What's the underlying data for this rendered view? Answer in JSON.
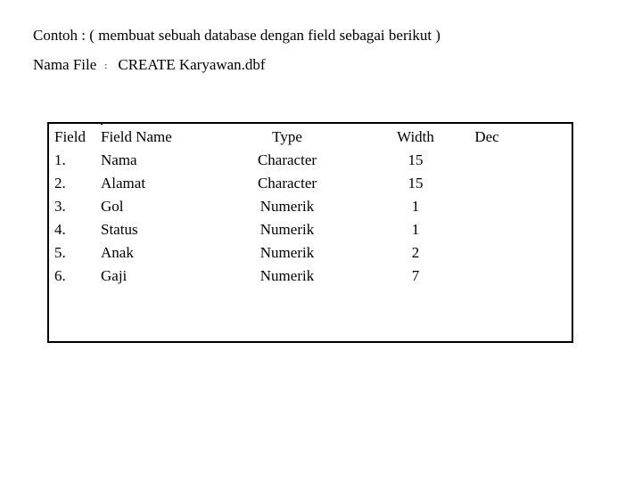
{
  "intro": "Contoh : ( membuat sebuah database dengan field sebagai berikut )",
  "file_label": "Nama File",
  "file_separator": ":",
  "file_command": "CREATE Karyawan.dbf",
  "table": {
    "headers": {
      "field": "Field",
      "name": "Field Name",
      "type": "Type",
      "width": "Width",
      "dec": "Dec"
    },
    "rows": [
      {
        "field": "1.",
        "name": "Nama",
        "type": "Character",
        "width": "15",
        "dec": ""
      },
      {
        "field": "2.",
        "name": "Alamat",
        "type": "Character",
        "width": "15",
        "dec": ""
      },
      {
        "field": "3.",
        "name": "Gol",
        "type": "Numerik",
        "width": "1",
        "dec": ""
      },
      {
        "field": "4.",
        "name": "Status",
        "type": "Numerik",
        "width": "1",
        "dec": ""
      },
      {
        "field": "5.",
        "name": "Anak",
        "type": "Numerik",
        "width": "2",
        "dec": ""
      },
      {
        "field": "6.",
        "name": "Gaji",
        "type": "Numerik",
        "width": "7",
        "dec": ""
      }
    ]
  }
}
